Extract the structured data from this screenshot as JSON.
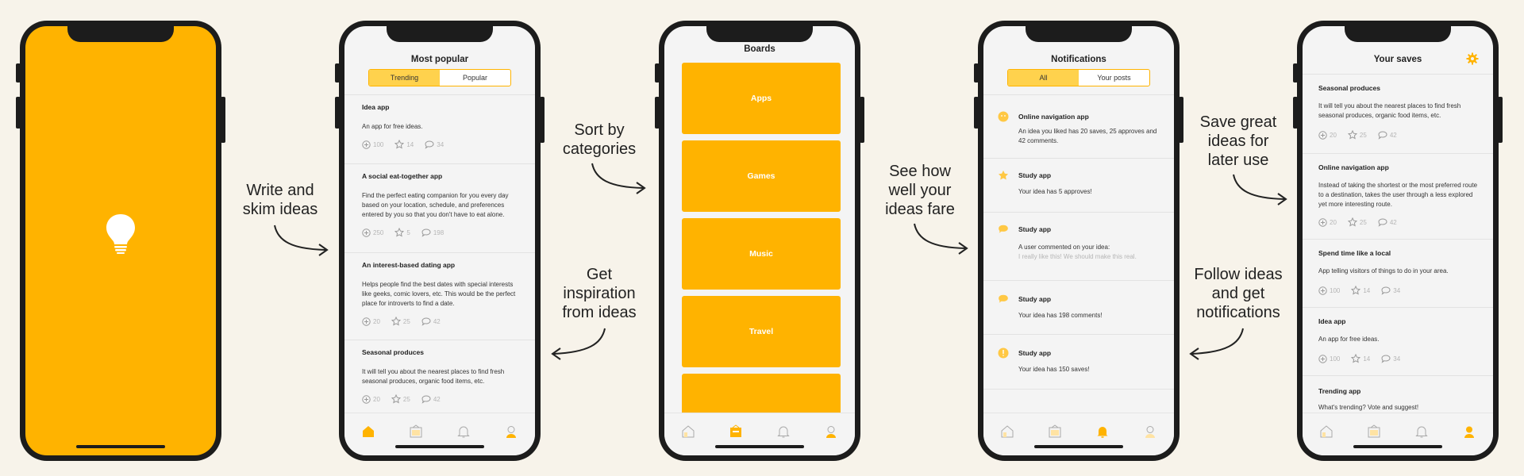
{
  "captions": {
    "write": "Write and skim ideas",
    "sort": "Sort by categories",
    "inspire": "Get inspiration from ideas",
    "fare": "See how well your ideas fare",
    "save": "Save great ideas for later use",
    "follow": "Follow ideas and get notifications"
  },
  "popular": {
    "title": "Most popular",
    "tabs": [
      "Trending",
      "Popular"
    ],
    "items": [
      {
        "title": "Idea app",
        "desc": "An app for free ideas.",
        "adds": "100",
        "stars": "14",
        "comments": "34"
      },
      {
        "title": "A social eat-together app",
        "desc": "Find the perfect eating companion for you every day based on your location, schedule, and preferences entered by you so that you don't have to eat alone.",
        "adds": "250",
        "stars": "5",
        "comments": "198"
      },
      {
        "title": "An interest-based dating app",
        "desc": "Helps people find the best dates with special interests like geeks, comic lovers, etc. This would be the perfect place for introverts to find a date.",
        "adds": "20",
        "stars": "25",
        "comments": "42"
      },
      {
        "title": "Seasonal produces",
        "desc": "It will tell you about the nearest places to find fresh seasonal produces, organic food items, etc.",
        "adds": "20",
        "stars": "25",
        "comments": "42"
      }
    ]
  },
  "boards": {
    "title": "Boards",
    "items": [
      "Apps",
      "Games",
      "Music",
      "Travel"
    ]
  },
  "notifications": {
    "title": "Notifications",
    "tabs": [
      "All",
      "Your posts"
    ],
    "items": [
      {
        "title": "Online navigation app",
        "desc": "An idea you liked has 20 saves, 25 approves and 42 comments.",
        "quote": "",
        "icon": "smiley-icon"
      },
      {
        "title": "Study app",
        "desc": "Your idea has 5 approves!",
        "quote": "",
        "icon": "star-icon"
      },
      {
        "title": "Study app",
        "desc": "A user commented on your idea:",
        "quote": "I really like this! We should make this real.",
        "icon": "comment-icon"
      },
      {
        "title": "Study app",
        "desc": "Your idea has 198 comments!",
        "quote": "",
        "icon": "comment-icon"
      },
      {
        "title": "Study app",
        "desc": "Your idea has 150 saves!",
        "quote": "",
        "icon": "alert-icon"
      }
    ]
  },
  "saves": {
    "title": "Your saves",
    "items": [
      {
        "title": "Seasonal produces",
        "desc": "It will tell you about the nearest places to find fresh seasonal produces, organic food items, etc.",
        "adds": "20",
        "stars": "25",
        "comments": "42"
      },
      {
        "title": "Online navigation app",
        "desc": "Instead of taking the shortest or the most preferred route to a destination, takes the user through a less explored yet more interesting route.",
        "adds": "20",
        "stars": "25",
        "comments": "42"
      },
      {
        "title": "Spend time like a local",
        "desc": "App telling visitors of things to do in your area.",
        "adds": "100",
        "stars": "14",
        "comments": "34"
      },
      {
        "title": "Idea app",
        "desc": "An app for free ideas.",
        "adds": "100",
        "stars": "14",
        "comments": "34"
      },
      {
        "title": "Trending app",
        "desc": "What's trending? Vote and suggest!",
        "adds": "",
        "stars": "",
        "comments": ""
      }
    ]
  },
  "colors": {
    "accent": "#ffb300",
    "accent_light": "#ffd24d",
    "bg": "#f7f3ea"
  }
}
